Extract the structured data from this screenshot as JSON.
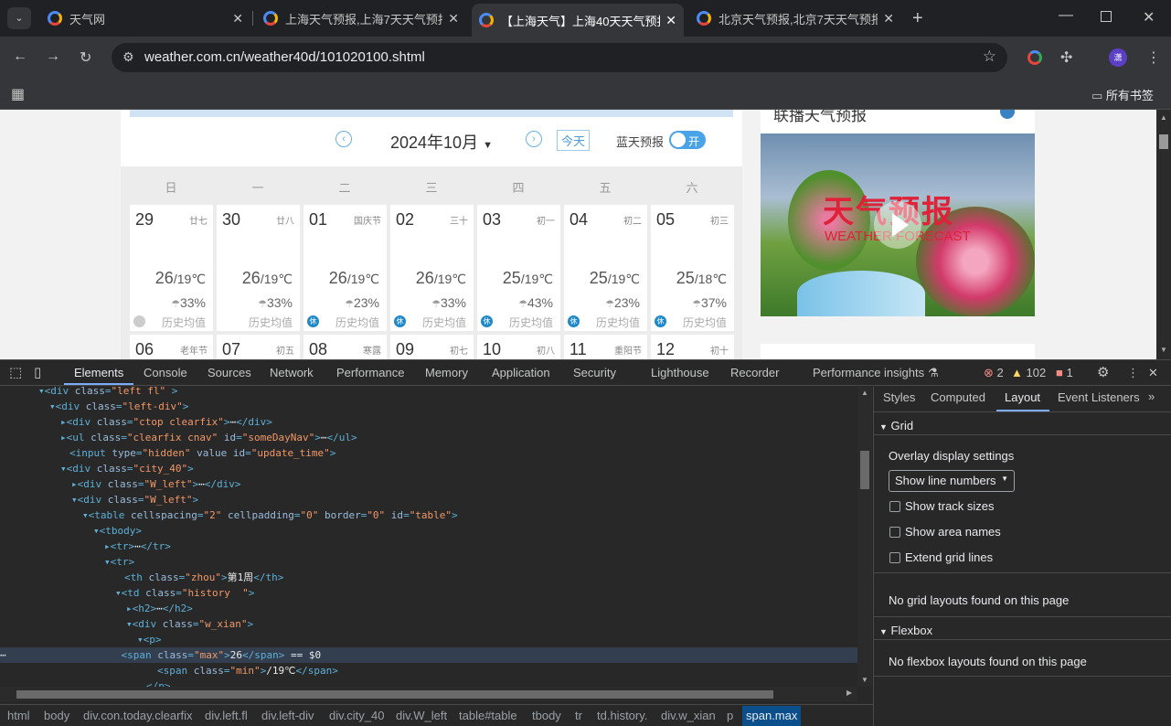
{
  "tabs": [
    {
      "title": "天气网"
    },
    {
      "title": "上海天气预报,上海7天天气预报"
    },
    {
      "title": "【上海天气】上海40天天气预报"
    },
    {
      "title": "北京天气预报,北京7天天气预报"
    }
  ],
  "address": {
    "url": "weather.com.cn/weather40d/101020100.shtml"
  },
  "bookmarks": {
    "all": "所有书签"
  },
  "calendar": {
    "month": "2024年10月",
    "today": "今天",
    "blue_sky_label": "蓝天预报",
    "toggle": "开",
    "weekdays": [
      "日",
      "一",
      "二",
      "三",
      "四",
      "五",
      "六"
    ],
    "days": [
      {
        "d": "29",
        "lunar": "廿七",
        "hi": "26",
        "lo": "/19℃",
        "rain": "33%",
        "hist": "历史均值",
        "badge": "grey"
      },
      {
        "d": "30",
        "lunar": "廿八",
        "hi": "26",
        "lo": "/19℃",
        "rain": "33%",
        "hist": "历史均值",
        "badge": ""
      },
      {
        "d": "01",
        "lunar": "国庆节",
        "hi": "26",
        "lo": "/19℃",
        "rain": "23%",
        "hist": "历史均值",
        "badge": "休"
      },
      {
        "d": "02",
        "lunar": "三十",
        "hi": "26",
        "lo": "/19℃",
        "rain": "33%",
        "hist": "历史均值",
        "badge": "休"
      },
      {
        "d": "03",
        "lunar": "初一",
        "hi": "25",
        "lo": "/19℃",
        "rain": "43%",
        "hist": "历史均值",
        "badge": "休"
      },
      {
        "d": "04",
        "lunar": "初二",
        "hi": "25",
        "lo": "/19℃",
        "rain": "23%",
        "hist": "历史均值",
        "badge": "休"
      },
      {
        "d": "05",
        "lunar": "初三",
        "hi": "25",
        "lo": "/18℃",
        "rain": "37%",
        "hist": "历史均值",
        "badge": "休"
      }
    ],
    "next_row": [
      {
        "d": "06",
        "lunar": "老年节"
      },
      {
        "d": "07",
        "lunar": "初五"
      },
      {
        "d": "08",
        "lunar": "寒露"
      },
      {
        "d": "09",
        "lunar": "初七"
      },
      {
        "d": "10",
        "lunar": "初八"
      },
      {
        "d": "11",
        "lunar": "重阳节"
      },
      {
        "d": "12",
        "lunar": "初十"
      }
    ]
  },
  "sidebar": {
    "heading": "联播天气预报",
    "video_title": "天气预报",
    "video_sub": "WEATHER FORECAST"
  },
  "devtools": {
    "tabs": [
      "Elements",
      "Console",
      "Sources",
      "Network",
      "Performance",
      "Memory",
      "Application",
      "Security",
      "Lighthouse",
      "Recorder",
      "Performance insights"
    ],
    "errors": "2",
    "warnings": "102",
    "issues": "1",
    "side_tabs": [
      "Styles",
      "Computed",
      "Layout",
      "Event Listeners"
    ],
    "grid_header": "Grid",
    "overlay": "Overlay display settings",
    "select": "Show line numbers",
    "checks": [
      "Show track sizes",
      "Show area names",
      "Extend grid lines"
    ],
    "no_grid": "No grid layouts found on this page",
    "flex_header": "Flexbox",
    "no_flex": "No flexbox layouts found on this page",
    "breadcrumbs": [
      "html",
      "body",
      "div.con.today.clearfix",
      "div.left.fl",
      "div.left-div",
      "div.city_40",
      "div.W_left",
      "table#table",
      "tbody",
      "tr",
      "td.history.",
      "div.w_xian",
      "p",
      "span.max"
    ]
  }
}
